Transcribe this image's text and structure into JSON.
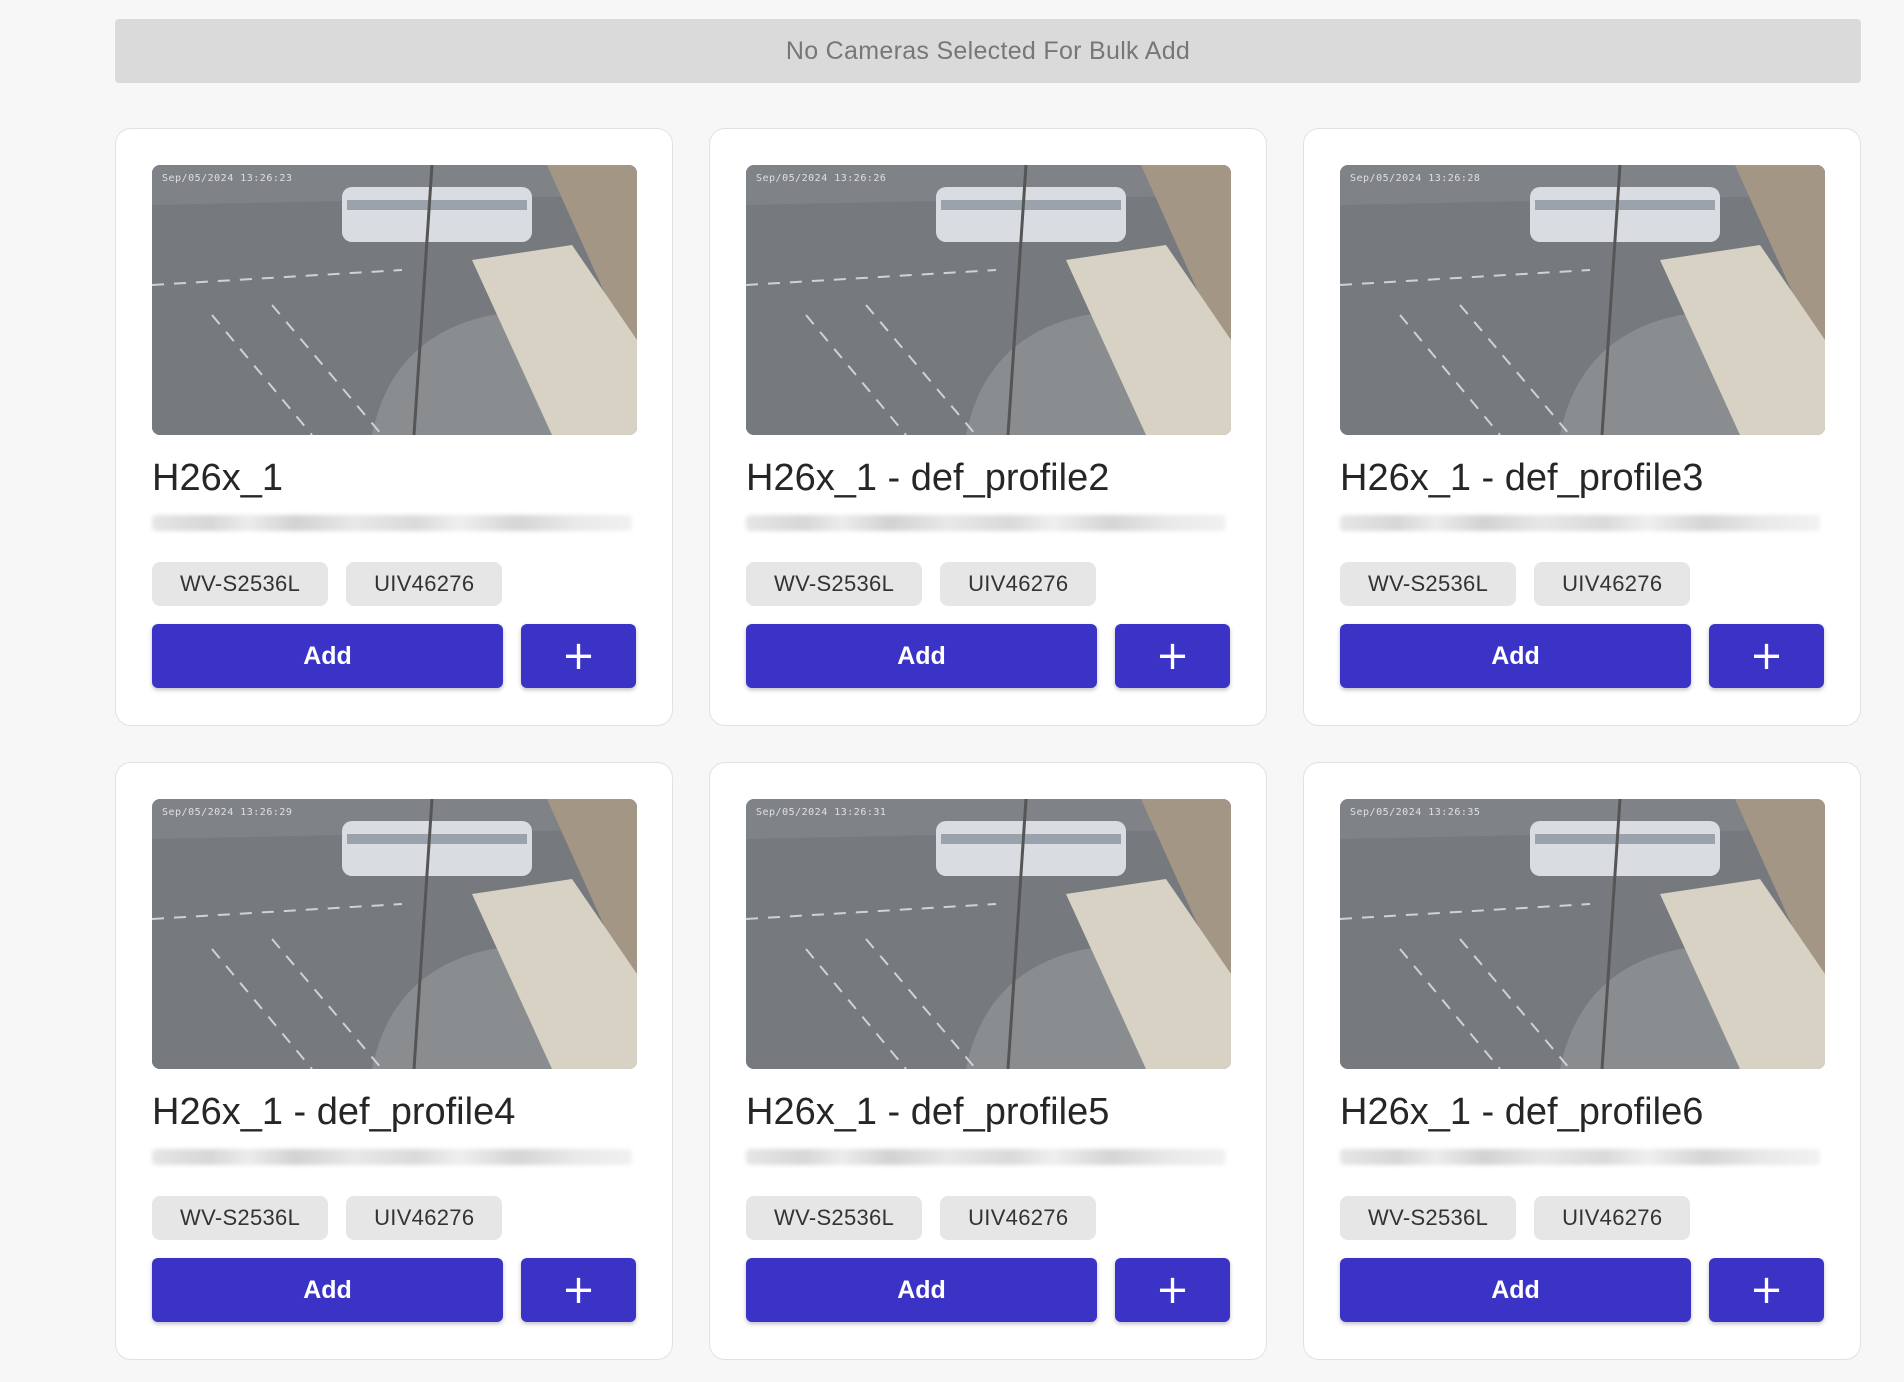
{
  "bulk_bar": {
    "text": "No Cameras Selected For Bulk Add"
  },
  "cameras": [
    {
      "timestamp": "Sep/05/2024 13:26:23",
      "title": "H26x_1",
      "model": "WV-S2536L",
      "serial": "UIV46276",
      "add_label": "Add",
      "plus_label": "+"
    },
    {
      "timestamp": "Sep/05/2024 13:26:26",
      "title": "H26x_1 - def_profile2",
      "model": "WV-S2536L",
      "serial": "UIV46276",
      "add_label": "Add",
      "plus_label": "+"
    },
    {
      "timestamp": "Sep/05/2024 13:26:28",
      "title": "H26x_1 - def_profile3",
      "model": "WV-S2536L",
      "serial": "UIV46276",
      "add_label": "Add",
      "plus_label": "+"
    },
    {
      "timestamp": "Sep/05/2024 13:26:29",
      "title": "H26x_1 - def_profile4",
      "model": "WV-S2536L",
      "serial": "UIV46276",
      "add_label": "Add",
      "plus_label": "+"
    },
    {
      "timestamp": "Sep/05/2024 13:26:31",
      "title": "H26x_1 - def_profile5",
      "model": "WV-S2536L",
      "serial": "UIV46276",
      "add_label": "Add",
      "plus_label": "+"
    },
    {
      "timestamp": "Sep/05/2024 13:26:35",
      "title": "H26x_1 - def_profile6",
      "model": "WV-S2536L",
      "serial": "UIV46276",
      "add_label": "Add",
      "plus_label": "+"
    }
  ],
  "colors": {
    "primary_button": "#3b33c6",
    "chip_bg": "#e6e6e6",
    "bulk_bar_bg": "#dadada",
    "page_bg": "#f7f7f7"
  },
  "icons": {
    "plus": "plus-icon",
    "thumbnail": "camera-snapshot"
  }
}
